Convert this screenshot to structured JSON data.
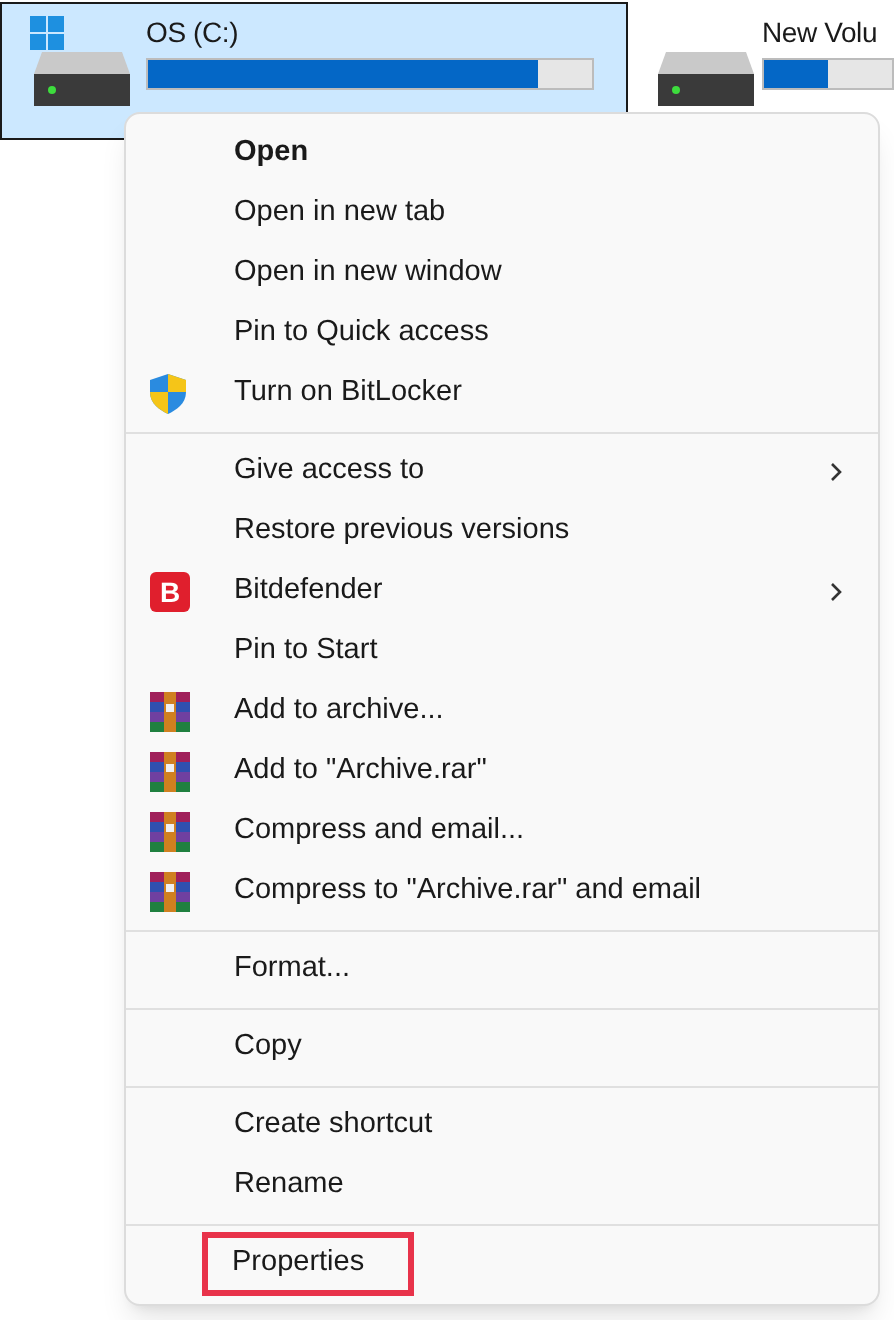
{
  "drives": [
    {
      "name": "OS (C:)",
      "level": 0.88,
      "selected": true,
      "system": true
    },
    {
      "name": "New Volu",
      "level": 0.5,
      "selected": false,
      "system": false
    }
  ],
  "menu": [
    {
      "kind": "plain",
      "label": "Open",
      "default": true
    },
    {
      "kind": "plain",
      "label": "Open in new tab"
    },
    {
      "kind": "plain",
      "label": "Open in new window"
    },
    {
      "kind": "plain",
      "label": "Pin to Quick access"
    },
    {
      "kind": "shield",
      "label": "Turn on BitLocker"
    },
    {
      "kind": "separator"
    },
    {
      "kind": "plain",
      "label": "Give access to",
      "submenu": true
    },
    {
      "kind": "plain",
      "label": "Restore previous versions"
    },
    {
      "kind": "bitdefender",
      "label": "Bitdefender",
      "icon_text": "B",
      "submenu": true
    },
    {
      "kind": "plain",
      "label": "Pin to Start"
    },
    {
      "kind": "archive",
      "label": "Add to archive..."
    },
    {
      "kind": "archive",
      "label": "Add to \"Archive.rar\""
    },
    {
      "kind": "archive",
      "label": "Compress and email..."
    },
    {
      "kind": "archive",
      "label": "Compress to \"Archive.rar\" and email"
    },
    {
      "kind": "separator"
    },
    {
      "kind": "plain",
      "label": "Format..."
    },
    {
      "kind": "separator"
    },
    {
      "kind": "plain",
      "label": "Copy"
    },
    {
      "kind": "separator"
    },
    {
      "kind": "plain",
      "label": "Create shortcut"
    },
    {
      "kind": "plain",
      "label": "Rename"
    },
    {
      "kind": "separator"
    },
    {
      "kind": "plain",
      "label": "Properties",
      "highlighted": true
    }
  ]
}
